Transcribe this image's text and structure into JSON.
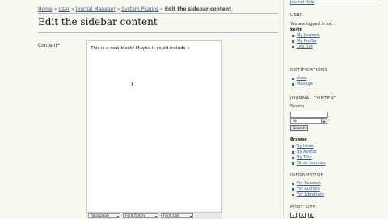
{
  "breadcrumb": {
    "items": [
      "Home",
      "User",
      "Journal Manager",
      "System Plugins"
    ],
    "sep": "»",
    "current": "Edit the sidebar content"
  },
  "page": {
    "title": "Edit the sidebar content",
    "content_label": "Content*"
  },
  "editor": {
    "text": "This is a new block! Maybe it could include s",
    "toolbar": {
      "format": "Paragraph",
      "font_family": "Font family",
      "font_size": "Font size"
    }
  },
  "sidebar": {
    "top_link": "Journal Help",
    "user": {
      "heading": "USER",
      "logged_in_as": "You are logged in as...",
      "username": "kevin",
      "links": [
        "My Journals",
        "My Profile",
        "Log Out"
      ]
    },
    "notifications": {
      "heading": "NOTIFICATIONS",
      "links": [
        "View",
        "Manage"
      ]
    },
    "journal_content": {
      "heading": "JOURNAL CONTENT",
      "search_label": "Search",
      "scope_value": "All",
      "search_button": "Search",
      "browse_label": "Browse",
      "browse_links": [
        "By Issue",
        "By Author",
        "By Title",
        "Other Journals"
      ]
    },
    "information": {
      "heading": "INFORMATION",
      "links": [
        "For Readers",
        "For Authors",
        "For Librarians"
      ]
    },
    "font_size": {
      "heading": "FONT SIZE",
      "options": [
        "A",
        "A",
        "A"
      ]
    }
  }
}
